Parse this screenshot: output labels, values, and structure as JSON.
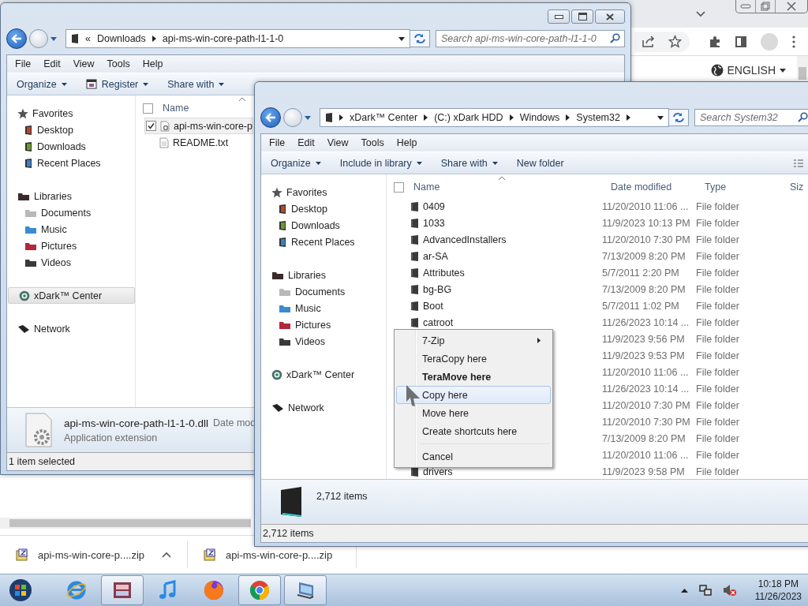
{
  "browser": {
    "language_button": "ENGLISH"
  },
  "windows": [
    {
      "kind": "back",
      "caption_buttons": true,
      "address": {
        "overflow_mark": "«",
        "crumbs": [
          "Downloads",
          "api-ms-win-core-path-l1-1-0"
        ],
        "trailing_arrow": false
      },
      "search": {
        "placeholder": "Search api-ms-win-core-path-l1-1-0"
      },
      "menu": [
        "File",
        "Edit",
        "View",
        "Tools",
        "Help"
      ],
      "toolbar": [
        {
          "label": "Organize",
          "dropdown": true
        },
        {
          "label": "Register",
          "dropdown": true,
          "kind": "register"
        },
        {
          "label": "Share with",
          "dropdown": true
        }
      ],
      "view_button": false,
      "nav": [
        {
          "label": "Favorites",
          "kind": "star",
          "selected": false,
          "children": [
            {
              "label": "Desktop",
              "kind": "desktop",
              "selected": false
            },
            {
              "label": "Downloads",
              "kind": "downloads",
              "selected": false
            },
            {
              "label": "Recent Places",
              "kind": "recent",
              "selected": false
            }
          ]
        },
        {
          "label": "Libraries",
          "kind": "library",
          "selected": false,
          "children": [
            {
              "label": "Documents",
              "kind": "documents",
              "selected": false
            },
            {
              "label": "Music",
              "kind": "music",
              "selected": false
            },
            {
              "label": "Pictures",
              "kind": "pictures",
              "selected": false
            },
            {
              "label": "Videos",
              "kind": "videos",
              "selected": false
            }
          ]
        },
        {
          "label": "xDark™ Center",
          "kind": "drive",
          "selected": true
        },
        {
          "label": "Network",
          "kind": "network",
          "selected": false
        }
      ],
      "select_all_checked": false,
      "columns": [
        "Name"
      ],
      "rows": [
        {
          "name": "api-ms-win-core-p",
          "kind": "dll",
          "selected": true
        },
        {
          "name": "README.txt",
          "kind": "text",
          "selected": false
        }
      ],
      "details": {
        "kind": "file",
        "name": "api-ms-win-core-path-l1-1-0.dll",
        "label": "Date mod",
        "type": "Application extension"
      },
      "status": "1 item selected"
    },
    {
      "kind": "front",
      "caption_buttons": false,
      "address": {
        "crumbs": [
          "xDark™ Center",
          "(C:) xDark HDD",
          "Windows",
          "System32"
        ],
        "trailing_arrow": true
      },
      "search": {
        "placeholder": "Search System32"
      },
      "menu": [
        "File",
        "Edit",
        "View",
        "Tools",
        "Help"
      ],
      "toolbar": [
        {
          "label": "Organize",
          "dropdown": true
        },
        {
          "label": "Include in library",
          "dropdown": true
        },
        {
          "label": "Share with",
          "dropdown": true
        },
        {
          "label": "New folder",
          "dropdown": false
        }
      ],
      "view_button": true,
      "nav": [
        {
          "label": "Favorites",
          "kind": "star",
          "selected": false,
          "children": [
            {
              "label": "Desktop",
              "kind": "desktop",
              "selected": false
            },
            {
              "label": "Downloads",
              "kind": "downloads",
              "selected": false
            },
            {
              "label": "Recent Places",
              "kind": "recent",
              "selected": false
            }
          ]
        },
        {
          "label": "Libraries",
          "kind": "library",
          "selected": false,
          "children": [
            {
              "label": "Documents",
              "kind": "documents",
              "selected": false
            },
            {
              "label": "Music",
              "kind": "music",
              "selected": false
            },
            {
              "label": "Pictures",
              "kind": "pictures",
              "selected": false
            },
            {
              "label": "Videos",
              "kind": "videos",
              "selected": false
            }
          ]
        },
        {
          "label": "xDark™ Center",
          "kind": "drive",
          "selected": false
        },
        {
          "label": "Network",
          "kind": "network",
          "selected": false
        }
      ],
      "select_all_checked": false,
      "columns": [
        "Name",
        "Date modified",
        "Type",
        "Siz"
      ],
      "rows": [
        {
          "name": "0409",
          "kind": "folder",
          "date": "11/20/2010 11:06 ...",
          "type": "File folder"
        },
        {
          "name": "1033",
          "kind": "folder",
          "date": "11/9/2023 10:13 PM",
          "type": "File folder"
        },
        {
          "name": "AdvancedInstallers",
          "kind": "folder",
          "date": "11/20/2010 7:30 PM",
          "type": "File folder"
        },
        {
          "name": "ar-SA",
          "kind": "folder",
          "date": "7/13/2009 8:20 PM",
          "type": "File folder"
        },
        {
          "name": "Attributes",
          "kind": "folder",
          "date": "5/7/2011 2:20 PM",
          "type": "File folder"
        },
        {
          "name": "bg-BG",
          "kind": "folder",
          "date": "7/13/2009 8:20 PM",
          "type": "File folder"
        },
        {
          "name": "Boot",
          "kind": "folder",
          "date": "5/7/2011 1:02 PM",
          "type": "File folder"
        },
        {
          "name": "catroot",
          "kind": "folder",
          "date": "11/26/2023 10:14 ...",
          "type": "File folder"
        },
        {
          "date": "11/9/2023 9:56 PM",
          "type": "File folder"
        },
        {
          "date": "11/9/2023 9:53 PM",
          "type": "File folder"
        },
        {
          "date": "11/20/2010 11:06 ...",
          "type": "File folder"
        },
        {
          "date": "11/26/2023 10:14 ...",
          "type": "File folder"
        },
        {
          "date": "11/20/2010 7:30 PM",
          "type": "File folder"
        },
        {
          "date": "11/20/2010 7:30 PM",
          "type": "File folder"
        },
        {
          "date": "7/13/2009 8:20 PM",
          "type": "File folder"
        },
        {
          "date": "11/20/2010 11:06 ...",
          "type": "File folder"
        },
        {
          "name": "drivers",
          "kind": "folder",
          "date": "11/9/2023 9:58 PM",
          "type": "File folder"
        }
      ],
      "details": {
        "kind": "folder",
        "count": "2,712 items"
      },
      "status": "2,712 items"
    }
  ],
  "context_menu": [
    {
      "kind": "item",
      "label": "7-Zip",
      "submenu": true,
      "default": false,
      "selected": false
    },
    {
      "kind": "item",
      "label": "TeraCopy here",
      "submenu": false,
      "default": false,
      "selected": false
    },
    {
      "kind": "item",
      "label": "TeraMove here",
      "submenu": false,
      "default": true,
      "selected": false
    },
    {
      "kind": "item",
      "label": "Copy here",
      "submenu": false,
      "default": false,
      "selected": true
    },
    {
      "kind": "item",
      "label": "Move here",
      "submenu": false,
      "default": false,
      "selected": false
    },
    {
      "kind": "item",
      "label": "Create shortcuts here",
      "submenu": false,
      "default": false,
      "selected": false
    },
    {
      "kind": "separator"
    },
    {
      "kind": "item",
      "label": "Cancel",
      "submenu": false,
      "default": false,
      "selected": false
    }
  ],
  "downloads": [
    {
      "name": "api-ms-win-core-p....zip",
      "menu_caret": true
    },
    {
      "name": "api-ms-win-core-p....zip",
      "menu_caret": false
    }
  ],
  "taskbar": {
    "apps": [
      {
        "kind": "ie",
        "open": false
      },
      {
        "kind": "archive",
        "open": true
      },
      {
        "kind": "music",
        "open": false
      },
      {
        "kind": "firefox",
        "open": false
      },
      {
        "kind": "chrome",
        "open": true
      },
      {
        "kind": "explorer",
        "open": true
      }
    ],
    "clock": {
      "time": "10:18 PM",
      "date": "11/26/2023"
    }
  }
}
